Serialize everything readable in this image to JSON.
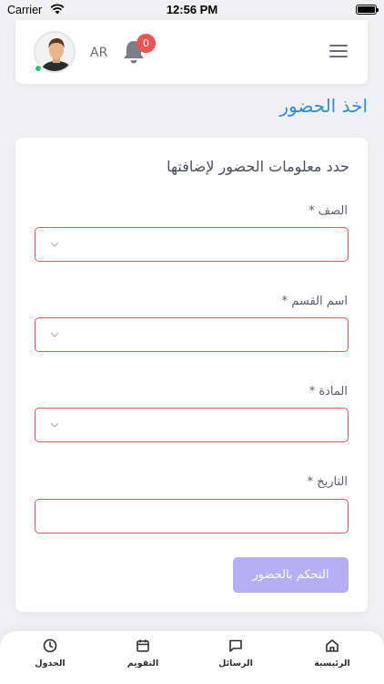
{
  "status_bar": {
    "carrier": "Carrier",
    "time": "12:56 PM"
  },
  "header": {
    "language": "AR",
    "notification_count": "0"
  },
  "page": {
    "title": "اخذ الحضور"
  },
  "form": {
    "heading": "حدد معلومات الحضور لإضافتها",
    "fields": [
      {
        "label": "الصف *",
        "value": "",
        "type": "select"
      },
      {
        "label": "اسم القسم *",
        "value": "",
        "type": "select"
      },
      {
        "label": "المادة *",
        "value": "",
        "type": "select"
      },
      {
        "label": "التاريخ *",
        "value": "",
        "type": "date"
      }
    ],
    "submit_label": "التحكم بالحضور"
  },
  "bottom_nav": {
    "items": [
      {
        "label": "الجدول",
        "icon": "clock-icon"
      },
      {
        "label": "التقويم",
        "icon": "calendar-icon"
      },
      {
        "label": "الرسائل",
        "icon": "message-icon"
      },
      {
        "label": "الرئيسية",
        "icon": "home-icon"
      }
    ]
  },
  "colors": {
    "accent": "#2a8fdd",
    "error_border": "#ea5455",
    "button": "#b5aff4",
    "online": "#28c76f"
  }
}
